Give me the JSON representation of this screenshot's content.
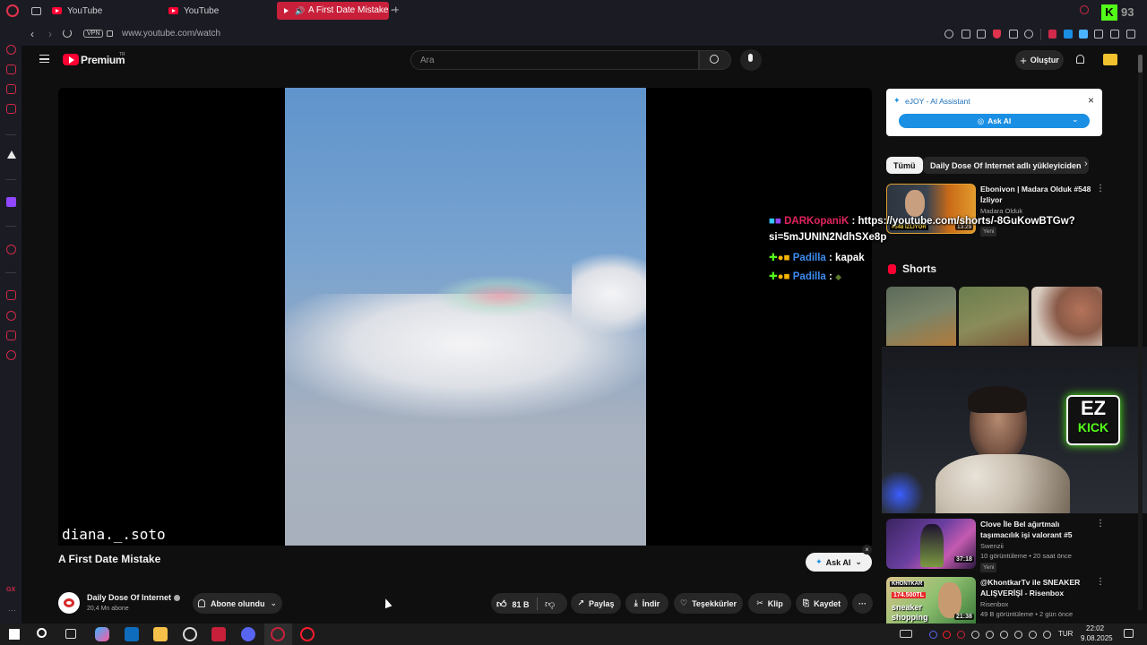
{
  "browser": {
    "tabs": [
      {
        "label": "YouTube"
      },
      {
        "label": "YouTube"
      },
      {
        "label": "A First Date Mistake -"
      }
    ],
    "vpn_label": "VPN",
    "url": "www.youtube.com/watch",
    "ext_badge": "93"
  },
  "header": {
    "logo_text": "Premium",
    "logo_badge": "TR",
    "search_placeholder": "Ara",
    "create_label": "Oluştur"
  },
  "video": {
    "watermark": "diana._.soto",
    "title": "A First Date Mistake",
    "channel_name": "Daily Dose Of Internet",
    "subscribers": "20,4 Mn abone",
    "subscribe_label": "Abone olundu",
    "like_count": "81 B",
    "share_label": "Paylaş",
    "download_label": "İndir",
    "thanks_label": "Teşekkürler",
    "clip_label": "Klip",
    "save_label": "Kaydet",
    "ask_ai_label": "Ask AI"
  },
  "ejoy": {
    "title": "eJOY - AI Assistant",
    "ask_label": "Ask AI"
  },
  "chips": [
    {
      "label": "Tümü"
    },
    {
      "label": "Daily Dose Of Internet adlı yükleyiciden"
    }
  ],
  "recommendations": [
    {
      "title_line1": "Ebonivon | Madara Olduk #548",
      "title_line2": "İzliyor",
      "channel": "Madara Olduk",
      "badge": "Yeni",
      "thumb_label": "#548 İZLİYOR",
      "duration": "13:29"
    },
    {
      "title_line1": "Clove İle Bel ağırtmalı",
      "title_line2": "taşımacılık işi valorant #5",
      "channel": "Swenzii",
      "stats": "10 görüntüleme • 20 saat önce",
      "badge": "Yeni",
      "duration": "37:18"
    },
    {
      "title_line1": "@KhontkarTv  ile SNEAKER",
      "title_line2": "ALIŞVERİŞİ - Risenbox",
      "channel": "Risenbox",
      "stats": "49 B görüntüleme • 2 gün önce",
      "thumb_label": "KHONTKAR",
      "thumb_text2": "174.500TL",
      "thumb_text3": "sneaker",
      "thumb_text4": "shopping",
      "duration": "21:38"
    }
  ],
  "shorts": {
    "title": "Shorts"
  },
  "chat": [
    {
      "user": "DARKopaniK",
      "message": " : https://youtube.com/shorts/-8GuKowBTGw?",
      "message2": "si=5mJUNIN2NdhSXe8p"
    },
    {
      "user": "Padilla",
      "message": " : kapak"
    },
    {
      "user": "Padilla",
      "message": " :"
    }
  ],
  "overlay": {
    "logo_line1": "EZ",
    "logo_line2": "KICK"
  },
  "taskbar": {
    "lang": "TUR",
    "time": "22:02",
    "date": "9.08.2025"
  },
  "colors": {
    "accent": "#c8203a",
    "yt_red": "#ff0033",
    "ejoy_blue": "#1a8fe3",
    "chat_user_red": "#e0245e",
    "chat_user_blue": "#3d8bf0",
    "kick_green": "#53fc18"
  }
}
